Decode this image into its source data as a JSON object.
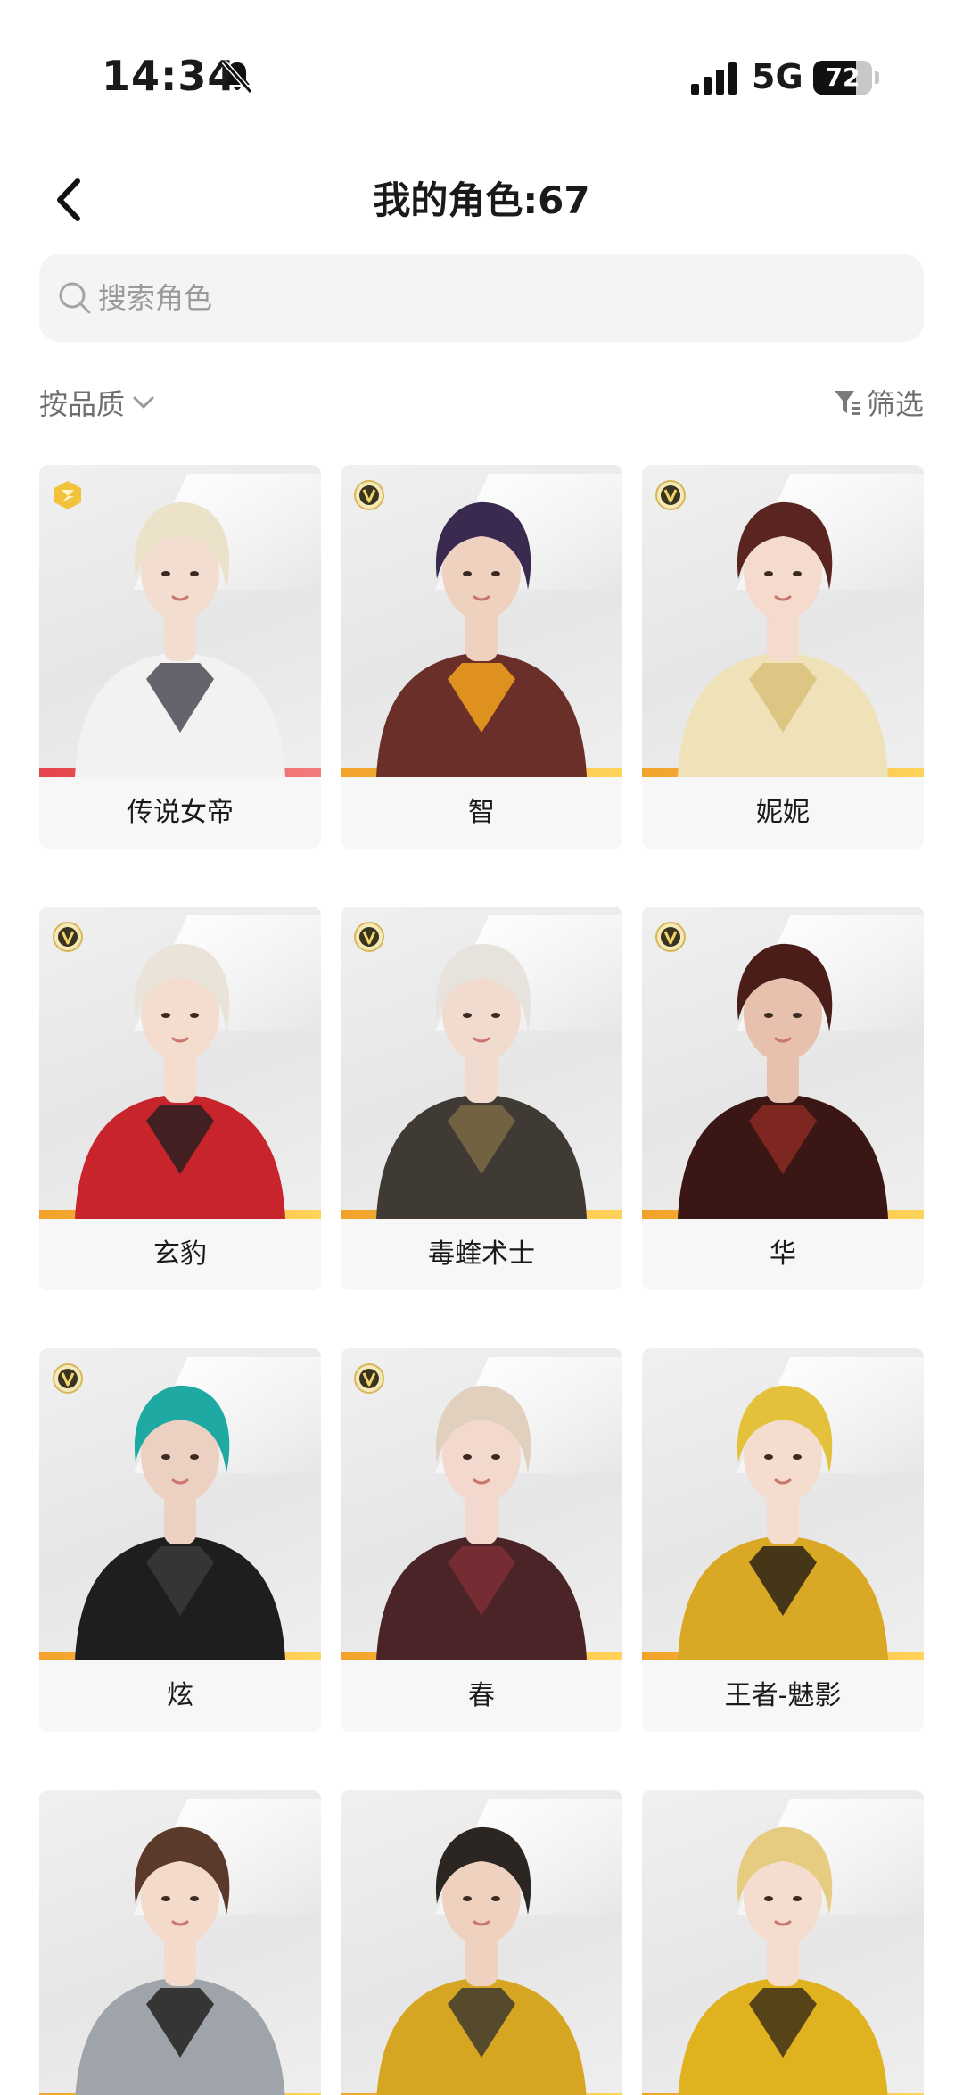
{
  "status_bar": {
    "time": "14:34",
    "network": "5G",
    "battery": 72
  },
  "header": {
    "title": "我的角色:67"
  },
  "search": {
    "placeholder": "搜索角色"
  },
  "toolbar": {
    "sort_label": "按品质",
    "filter_label": "筛选"
  },
  "characters": [
    {
      "name": "传说女帝",
      "badge": "legend",
      "hair": "#ece2c9",
      "top": "#f2f2f2",
      "accent": "#4b4b55",
      "skin": "#f3ddd0"
    },
    {
      "name": "智",
      "badge": "v",
      "hair": "#3b2a4f",
      "top": "#6b2f2a",
      "accent": "#f3a21d",
      "skin": "#efd1c0"
    },
    {
      "name": "妮妮",
      "badge": "v",
      "hair": "#5a2420",
      "top": "#efe2b9",
      "accent": "#d9c07a",
      "skin": "#f4dbcd"
    },
    {
      "name": "玄豹",
      "badge": "v",
      "hair": "#e9e3d9",
      "top": "#c7242b",
      "accent": "#2a2020",
      "skin": "#f4dccf"
    },
    {
      "name": "毒蝰术士",
      "badge": "v",
      "hair": "#e7e3dc",
      "top": "#3f3a33",
      "accent": "#7b6a45",
      "skin": "#f1dbcf"
    },
    {
      "name": "华",
      "badge": "v",
      "hair": "#4a1d18",
      "top": "#3a1614",
      "accent": "#8b2a22",
      "skin": "#e7c1ad"
    },
    {
      "name": "炫",
      "badge": "v",
      "hair": "#1fa9a3",
      "top": "#1e1e1e",
      "accent": "#3a3a3a",
      "skin": "#ecd0c2"
    },
    {
      "name": "春",
      "badge": "v",
      "hair": "#e1d0bd",
      "top": "#4a2426",
      "accent": "#7d2e35",
      "skin": "#f2d8cd"
    },
    {
      "name": "王者-魅影",
      "badge": "none",
      "hair": "#e3c13a",
      "top": "#d9a824",
      "accent": "#2a2216",
      "skin": "#f4dccf"
    },
    {
      "name": "",
      "badge": "none",
      "hair": "#5b3a2b",
      "top": "#9fa4aa",
      "accent": "#222",
      "skin": "#f3dacb"
    },
    {
      "name": "",
      "badge": "none",
      "hair": "#2b2622",
      "top": "#d6a521",
      "accent": "#3e3a2e",
      "skin": "#efd1bf"
    },
    {
      "name": "",
      "badge": "none",
      "hair": "#e6cc80",
      "top": "#e0b21f",
      "accent": "#3e2f18",
      "skin": "#f4dccf"
    }
  ]
}
